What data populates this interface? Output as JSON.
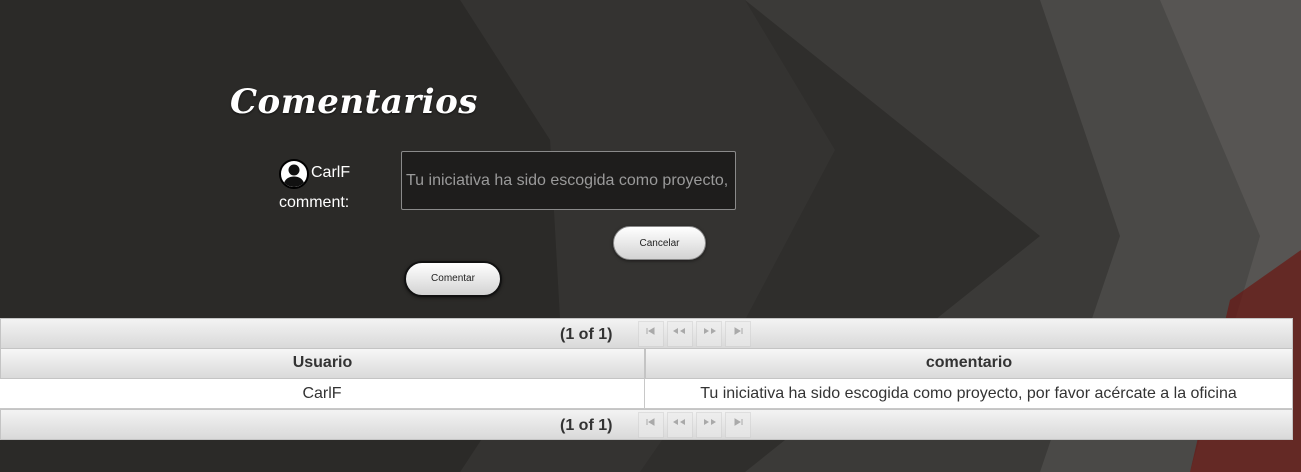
{
  "page": {
    "title": "Comentarios",
    "background_colors": [
      "#2e2d2b",
      "#3a3937",
      "#4b4a48",
      "#5a5856",
      "#7a1a14"
    ]
  },
  "form": {
    "username": "CarlF",
    "avatar_icon": "user-circle-icon",
    "comment_label": "comment:",
    "comment_value": "Tu iniciativa ha sido escogida como proyecto, por favor acércate a la oficina",
    "cancel_label": "Cancelar",
    "submit_label": "Comentar"
  },
  "table": {
    "page_report": "(1 of 1)",
    "paginator_icons": [
      "first-page-icon",
      "previous-page-icon",
      "next-page-icon",
      "last-page-icon"
    ],
    "columns": [
      "Usuario",
      "comentario"
    ],
    "rows": [
      [
        "CarlF",
        "Tu iniciativa ha sido escogida como proyecto, por favor acércate a la oficina"
      ]
    ]
  }
}
